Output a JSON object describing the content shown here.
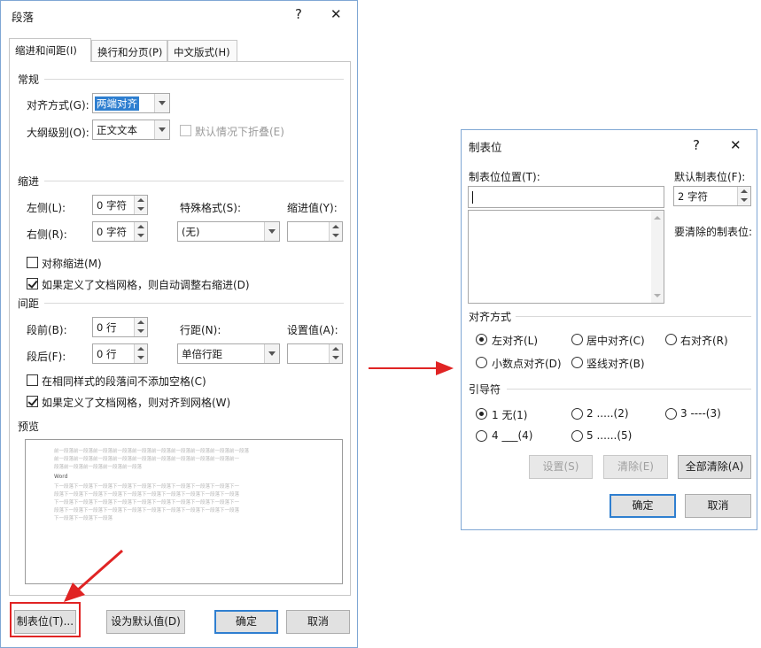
{
  "colors": {
    "accent": "#2f7fd0",
    "highlight": "#e02424",
    "arrow": "#e02424"
  },
  "para": {
    "title": "段落",
    "help": "?",
    "close": "✕",
    "tabs": [
      "缩进和间距(I)",
      "换行和分页(P)",
      "中文版式(H)"
    ],
    "general": {
      "heading": "常规",
      "align_label": "对齐方式(G):",
      "align_value": "两端对齐",
      "outline_label": "大纲级别(O):",
      "outline_value": "正文文本",
      "collapse_label": "默认情况下折叠(E)"
    },
    "indent": {
      "heading": "缩进",
      "left_label": "左侧(L):",
      "left_value": "0 字符",
      "right_label": "右侧(R):",
      "right_value": "0 字符",
      "special_label": "特殊格式(S):",
      "special_value": "(无)",
      "by_label": "缩进值(Y):",
      "by_value": "",
      "mirror_label": "对称缩进(M)",
      "auto_label": "如果定义了文档网格，则自动调整右缩进(D)"
    },
    "spacing": {
      "heading": "间距",
      "before_label": "段前(B):",
      "before_value": "0 行",
      "after_label": "段后(F):",
      "after_value": "0 行",
      "line_label": "行距(N):",
      "line_value": "单倍行距",
      "at_label": "设置值(A):",
      "at_value": "",
      "nospace_label": "在相同样式的段落间不添加空格(C)",
      "snap_label": "如果定义了文档网格，则对齐到网格(W)"
    },
    "preview": {
      "heading": "预览",
      "before_lines": [
        "前一段落前一段落前一段落前一段落前一段落前一段落前一段落前一段落前一段落前一段落",
        "前一段落前一段落前一段落前一段落前一段落前一段落前一段落前一段落前一段落前一",
        "段落前一段落前一段落前一段落前一段落"
      ],
      "word": "Word",
      "after_lines": [
        "下一段落下一段落下一段落下一段落下一段落下一段落下一段落下一段落下一段落下一",
        "段落下一段落下一段落下一段落下一段落下一段落下一段落下一段落下一段落下一段落",
        "下一段落下一段落下一段落下一段落下一段落下一段落下一段落下一段落下一段落下一",
        "段落下一段落下一段落下一段落下一段落下一段落下一段落下一段落下一段落下一段落",
        "下一段落下一段落下一段落"
      ]
    },
    "buttons": {
      "tabs": "制表位(T)...",
      "default": "设为默认值(D)",
      "ok": "确定",
      "cancel": "取消"
    }
  },
  "tabsdlg": {
    "title": "制表位",
    "help": "?",
    "close": "✕",
    "pos_label": "制表位位置(T):",
    "pos_value": "",
    "default_label": "默认制表位(F):",
    "default_value": "2 字符",
    "clear_label": "要清除的制表位:",
    "align_heading": "对齐方式",
    "align_options": [
      "左对齐(L)",
      "居中对齐(C)",
      "右对齐(R)",
      "小数点对齐(D)",
      "竖线对齐(B)"
    ],
    "leader_heading": "引导符",
    "leader_options": [
      "1 无(1)",
      "2 .....(2)",
      "3 ----(3)",
      "4 ___(4)",
      "5 ......(5)"
    ],
    "buttons": {
      "set": "设置(S)",
      "clear": "清除(E)",
      "clear_all": "全部清除(A)",
      "ok": "确定",
      "cancel": "取消"
    }
  }
}
